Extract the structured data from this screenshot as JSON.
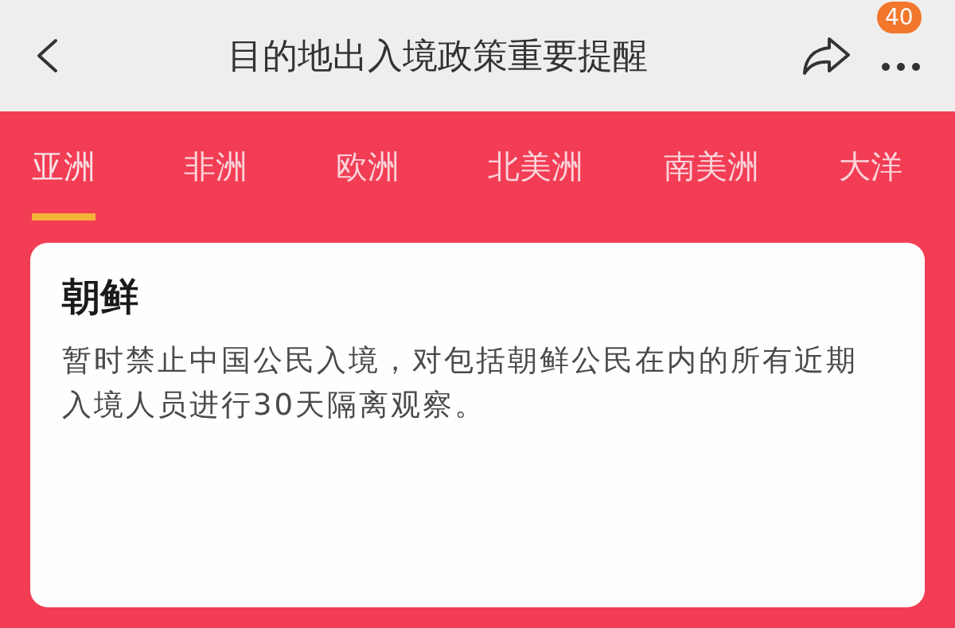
{
  "header": {
    "title": "目的地出入境政策重要提醒",
    "badge": "40"
  },
  "tabs": [
    {
      "label": "亚洲",
      "selected": true
    },
    {
      "label": "非洲",
      "selected": false
    },
    {
      "label": "欧洲",
      "selected": false
    },
    {
      "label": "北美洲",
      "selected": false
    },
    {
      "label": "南美洲",
      "selected": false
    },
    {
      "label": "大洋",
      "selected": false
    }
  ],
  "card": {
    "title": "朝鲜",
    "text": "暂时禁止中国公民入境，对包括朝鲜公民在内的所有近期入境人员进行30天隔离观察。"
  }
}
